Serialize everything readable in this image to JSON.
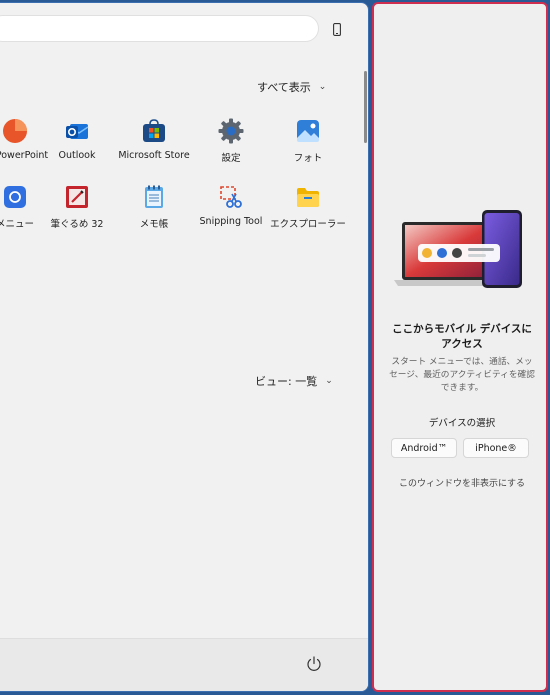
{
  "start_menu": {
    "show_all_label": "すべて表示",
    "apps_row1": [
      {
        "label": "PowerPoint",
        "icon": "powerpoint-icon"
      },
      {
        "label": "Outlook",
        "icon": "outlook-icon"
      },
      {
        "label": "Microsoft Store",
        "icon": "microsoft-store-icon"
      },
      {
        "label": "設定",
        "icon": "settings-gear-icon"
      },
      {
        "label": "フォト",
        "icon": "photos-icon"
      }
    ],
    "apps_row2": [
      {
        "label": "メニュー",
        "icon": "app-icon"
      },
      {
        "label": "筆ぐるめ 32",
        "icon": "fudegurume-icon"
      },
      {
        "label": "メモ帳",
        "icon": "notepad-icon"
      },
      {
        "label": "Snipping Tool",
        "icon": "snipping-tool-icon"
      },
      {
        "label": "エクスプローラー",
        "icon": "file-explorer-icon"
      }
    ],
    "view_label": "ビュー: 一覧"
  },
  "mobile_panel": {
    "title": "ここからモバイル デバイスにアクセス",
    "description": "スタート メニューでは、通話、メッセージ、最近のアクティビティを確認できます。",
    "device_select_label": "デバイスの選択",
    "android_button": "Android™",
    "iphone_button": "iPhone®",
    "hide_link": "このウィンドウを非表示にする"
  },
  "colors": {
    "accent_border": "#cf2e4f",
    "panel_bg": "#efefef",
    "desktop_bg": "#2a5a96"
  }
}
